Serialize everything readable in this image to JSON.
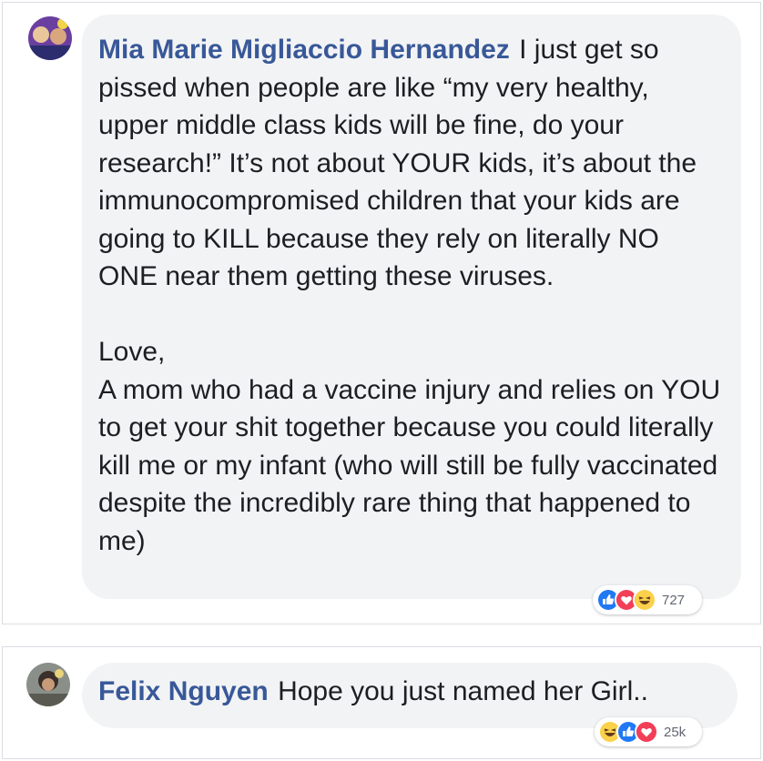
{
  "comments": [
    {
      "author": "Mia Marie Migliaccio Hernandez",
      "paragraphs": [
        "I just get so pissed when people are like “my very healthy, upper middle class kids will be fine, do your research!” It’s not about YOUR kids, it’s about the immunocompromised children that your kids are going to KILL because they rely on literally NO ONE near them getting these viruses.",
        "Love,",
        "A mom who had a vaccine injury and relies on YOU to get your shit together because you could literally kill me or my infant (who will still be fully vaccinated despite the incredibly rare thing that happened to me)"
      ],
      "reactions": {
        "icons": [
          "like-icon",
          "love-icon",
          "haha-icon"
        ],
        "count": "727"
      }
    },
    {
      "author": "Felix Nguyen",
      "text": "Hope you just named her Girl..",
      "reactions": {
        "icons": [
          "haha-icon",
          "like-icon",
          "love-icon"
        ],
        "count": "25k"
      }
    }
  ],
  "colors": {
    "author_link": "#385898",
    "bubble_bg": "#f2f3f5",
    "like_blue": "#2078f4",
    "love_red": "#f33e58",
    "haha_yellow": "#fbd14b"
  }
}
